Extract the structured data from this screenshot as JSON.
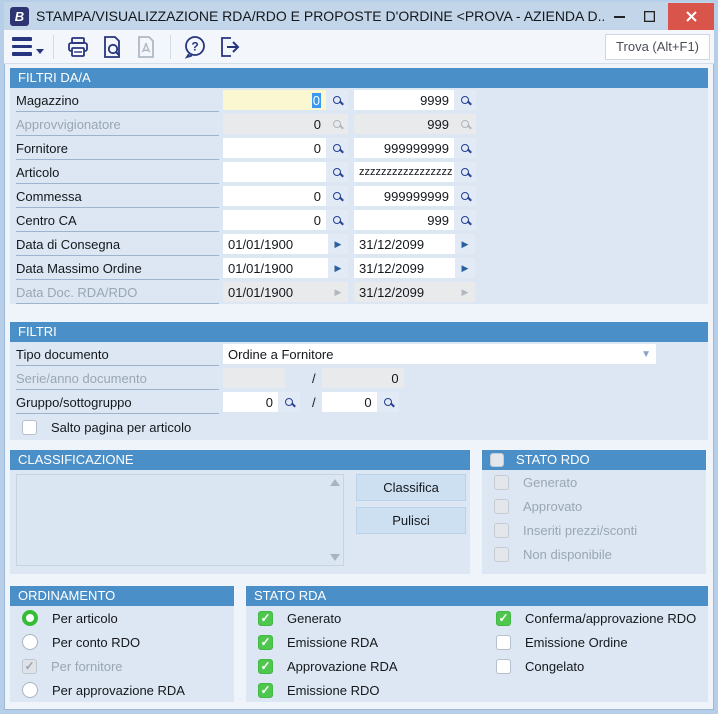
{
  "window": {
    "title": "STAMPA/VISUALIZZAZIONE RDA/RDO E PROPOSTE D'ORDINE <PROVA - AZIENDA D...",
    "app_initial": "B"
  },
  "toolbar": {
    "find_label": "Trova (Alt+F1)"
  },
  "colors": {
    "accent_blue": "#4a8fc7",
    "check_green": "#4fc74f",
    "close_red": "#d9544b",
    "focus_yellow": "#fbf7d0"
  },
  "filtri_da_a": {
    "title": "FILTRI DA/A",
    "rows": [
      {
        "label": "Magazzino",
        "from": "0",
        "to": "9999"
      },
      {
        "label": "Approvvigionatore",
        "from": "0",
        "to": "999"
      },
      {
        "label": "Fornitore",
        "from": "0",
        "to": "999999999"
      },
      {
        "label": "Articolo",
        "from": "",
        "to": "zzzzzzzzzzzzzzzzz"
      },
      {
        "label": "Commessa",
        "from": "0",
        "to": "999999999"
      },
      {
        "label": "Centro CA",
        "from": "0",
        "to": "999"
      },
      {
        "label": "Data di Consegna",
        "from": "01/01/1900",
        "to": "31/12/2099"
      },
      {
        "label": "Data Massimo Ordine",
        "from": "01/01/1900",
        "to": "31/12/2099"
      },
      {
        "label": "Data Doc. RDA/RDO",
        "from": "01/01/1900",
        "to": "31/12/2099"
      }
    ]
  },
  "filtri": {
    "title": "FILTRI",
    "tipo_documento_label": "Tipo documento",
    "tipo_documento_value": "Ordine a Fornitore",
    "serie_label": "Serie/anno documento",
    "serie_from": "",
    "serie_to": "0",
    "gruppo_label": "Gruppo/sottogruppo",
    "gruppo_from": "0",
    "gruppo_to": "0",
    "separator": "/",
    "salto_pagina_label": "Salto pagina per articolo"
  },
  "classificazione": {
    "title": "CLASSIFICAZIONE",
    "classifica_button": "Classifica",
    "pulisci_button": "Pulisci"
  },
  "stato_rdo": {
    "title": "STATO RDO",
    "items": [
      "Generato",
      "Approvato",
      "Inseriti prezzi/sconti",
      "Non disponibile"
    ]
  },
  "ordinamento": {
    "title": "ORDINAMENTO",
    "items": [
      "Per articolo",
      "Per conto RDO",
      "Per fornitore",
      "Per approvazione RDA"
    ]
  },
  "stato_rda": {
    "title": "STATO RDA",
    "left": [
      "Generato",
      "Emissione RDA",
      "Approvazione RDA",
      "Emissione RDO"
    ],
    "right": [
      "Conferma/approvazione RDO",
      "Emissione Ordine",
      "Congelato"
    ]
  }
}
